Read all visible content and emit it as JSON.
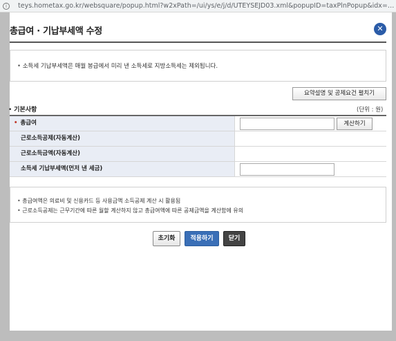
{
  "browser": {
    "url": "teys.hometax.go.kr/websquare/popup.html?w2xPath=/ui/ys/e/j/d/UTEYSEJD03.xml&popupID=taxPlnPopup&idx=idx..."
  },
  "popup": {
    "title": "총급여 · 기납부세액 수정",
    "close_label": "✕"
  },
  "notice": {
    "text": "소득세 기납부세액은 매월 봉급에서 미리 낸 소득세로 지방소득세는 제외됩니다."
  },
  "guide_button": "요약설명 및 공제요건 펼치기",
  "section": {
    "title": "기본사항",
    "unit": "(단위 : 원)"
  },
  "form": {
    "rows": [
      {
        "label": "총급여",
        "required_mark": "•",
        "input_value": "",
        "button": "계산하기"
      },
      {
        "label": "근로소득공제(자동계산)",
        "value": ""
      },
      {
        "label": "근로소득금액(자동계산)",
        "value": ""
      },
      {
        "label": "소득세 기납부세액(먼저 낸 세금)",
        "input_value": ""
      }
    ]
  },
  "notes": [
    "총급여액은 의료비 및 신용카드 등 사용금액 소득공제 계산 시 활용됨",
    "근로소득공제는 근무기간에 따른 월할 계산하지 않고 총급여액에 따른 공제금액을 계산함에 유의"
  ],
  "actions": {
    "reset": "초기화",
    "apply": "적용하기",
    "close": "닫기"
  },
  "colors": {
    "accent": "#3a6fb7",
    "close_icon_bg": "#2b5ca8",
    "label_bg": "#e9edf5",
    "overlay_gray": "#bdbdbd"
  }
}
